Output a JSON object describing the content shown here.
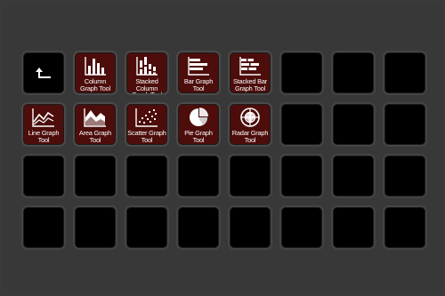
{
  "keys": [
    {
      "label": "",
      "icon": "back-arrow-icon"
    },
    {
      "label": "Column Graph Tool",
      "icon": "column-graph-icon"
    },
    {
      "label": "Stacked Column Graph Tool",
      "icon": "stacked-column-graph-icon"
    },
    {
      "label": "Bar Graph Tool",
      "icon": "bar-graph-icon"
    },
    {
      "label": "Stacked Bar Graph Tool",
      "icon": "stacked-bar-graph-icon"
    },
    {
      "label": "Line Graph Tool",
      "icon": "line-graph-icon"
    },
    {
      "label": "Area Graph Tool",
      "icon": "area-graph-icon"
    },
    {
      "label": "Scatter Graph Tool",
      "icon": "scatter-graph-icon"
    },
    {
      "label": "Pie Graph Tool",
      "icon": "pie-graph-icon"
    },
    {
      "label": "Radar Graph Tool",
      "icon": "radar-graph-icon"
    }
  ],
  "colors": {
    "key_bg": "#000000",
    "tool_bg": "#4c0d0b",
    "deck_bg": "#383838"
  }
}
